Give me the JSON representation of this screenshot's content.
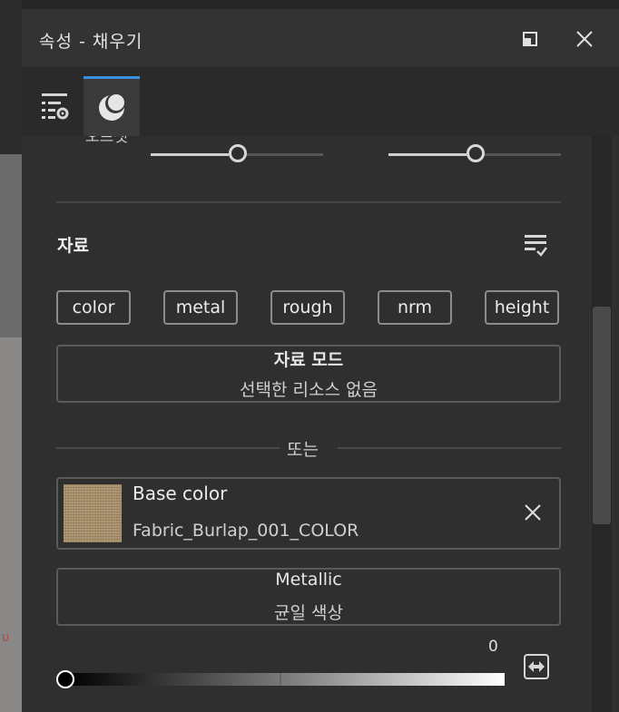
{
  "window": {
    "title": "속성 - 채우기"
  },
  "tabs": [
    {
      "name": "properties-tab",
      "icon": "settings-list-icon"
    },
    {
      "name": "fill-tab",
      "icon": "material-sphere-icon",
      "active": true
    }
  ],
  "top_section": {
    "cut_label": "오프셋"
  },
  "material": {
    "section_title": "자료",
    "channels": [
      "color",
      "metal",
      "rough",
      "nrm",
      "height"
    ],
    "mode_box": {
      "title": "자료 모드",
      "subtitle": "선택한 리소스 없음"
    },
    "or_label": "또는",
    "base_color": {
      "label": "Base color",
      "file": "Fabric_Burlap_001_COLOR"
    },
    "metallic": {
      "title": "Metallic",
      "subtitle": "균일 색상"
    },
    "metallic_value": "0"
  },
  "colors": {
    "accent": "#3b8fe0",
    "panel": "#2f2f2f"
  }
}
